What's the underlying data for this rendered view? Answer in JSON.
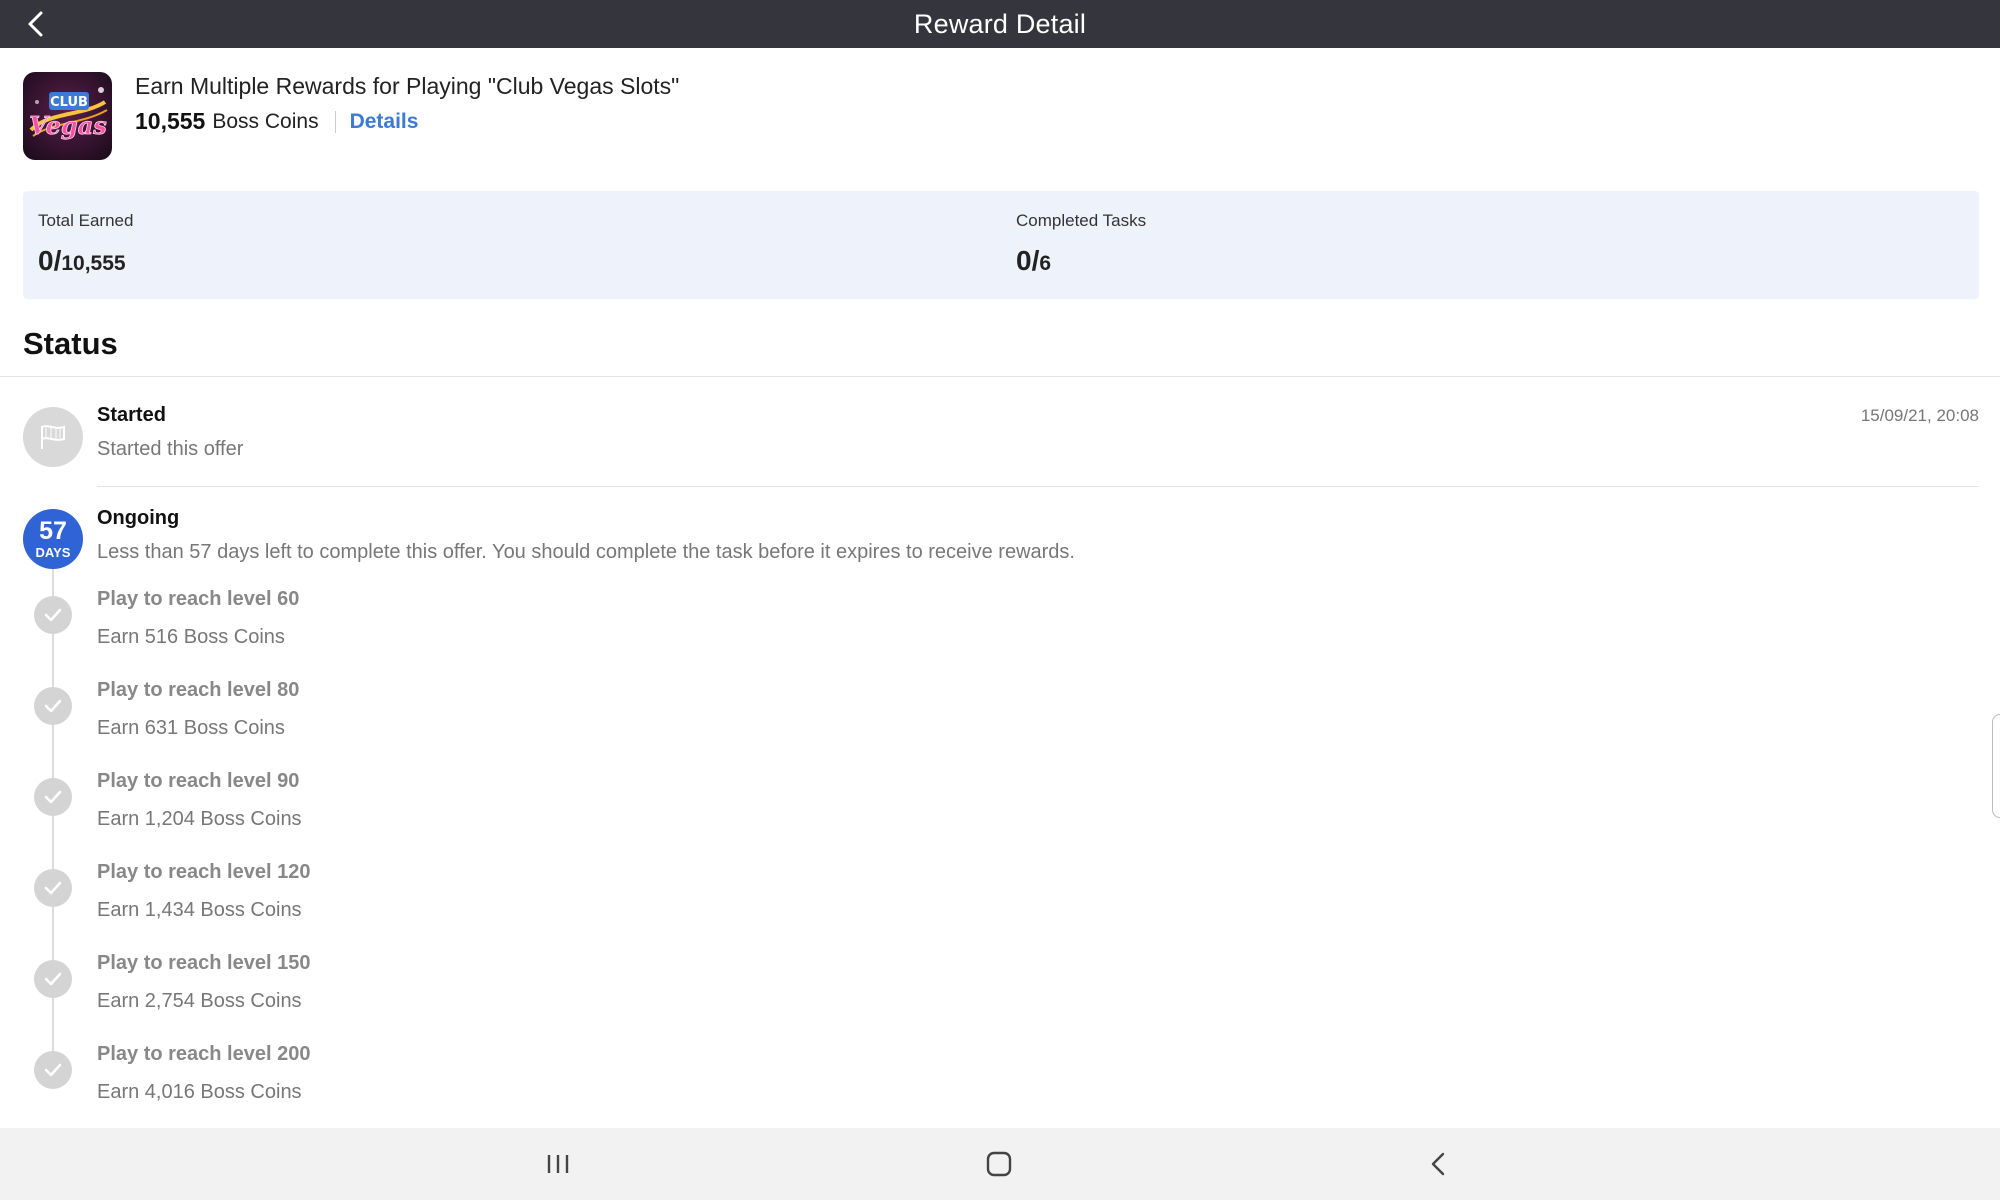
{
  "header": {
    "title": "Reward Detail",
    "back_icon": "chevron-left-icon"
  },
  "offer": {
    "logo_alt": "Club Vegas",
    "title": "Earn Multiple Rewards for Playing \"Club Vegas Slots\"",
    "amount": "10,555",
    "unit": "Boss Coins",
    "details_link": "Details"
  },
  "stats": {
    "total_earned": {
      "label": "Total Earned",
      "value": "0/",
      "total": "10,555"
    },
    "completed_tasks": {
      "label": "Completed Tasks",
      "value": "0/",
      "total": "6"
    }
  },
  "status": {
    "heading": "Status",
    "started": {
      "title": "Started",
      "description": "Started this offer",
      "timestamp": "15/09/21, 20:08"
    },
    "ongoing": {
      "days": "57",
      "days_unit": "DAYS",
      "title": "Ongoing",
      "description": "Less than 57 days left to complete this offer. You should complete the task before it expires to receive rewards."
    },
    "tasks": [
      {
        "title": "Play to reach level 60",
        "reward": "Earn 516 Boss Coins"
      },
      {
        "title": "Play to reach level 80",
        "reward": "Earn 631 Boss Coins"
      },
      {
        "title": "Play to reach level 90",
        "reward": "Earn 1,204 Boss Coins"
      },
      {
        "title": "Play to reach level 120",
        "reward": "Earn 1,434 Boss Coins"
      },
      {
        "title": "Play to reach level 150",
        "reward": "Earn 2,754 Boss Coins"
      },
      {
        "title": "Play to reach level 200",
        "reward": "Earn 4,016 Boss Coins"
      }
    ]
  },
  "colors": {
    "appbar": "#35353d",
    "accent": "#2f63d6",
    "link": "#3b7bd6",
    "stats_bg": "#eef2fb"
  },
  "navbar": {
    "icons": [
      "recent-apps-icon",
      "home-icon",
      "back-icon"
    ]
  }
}
